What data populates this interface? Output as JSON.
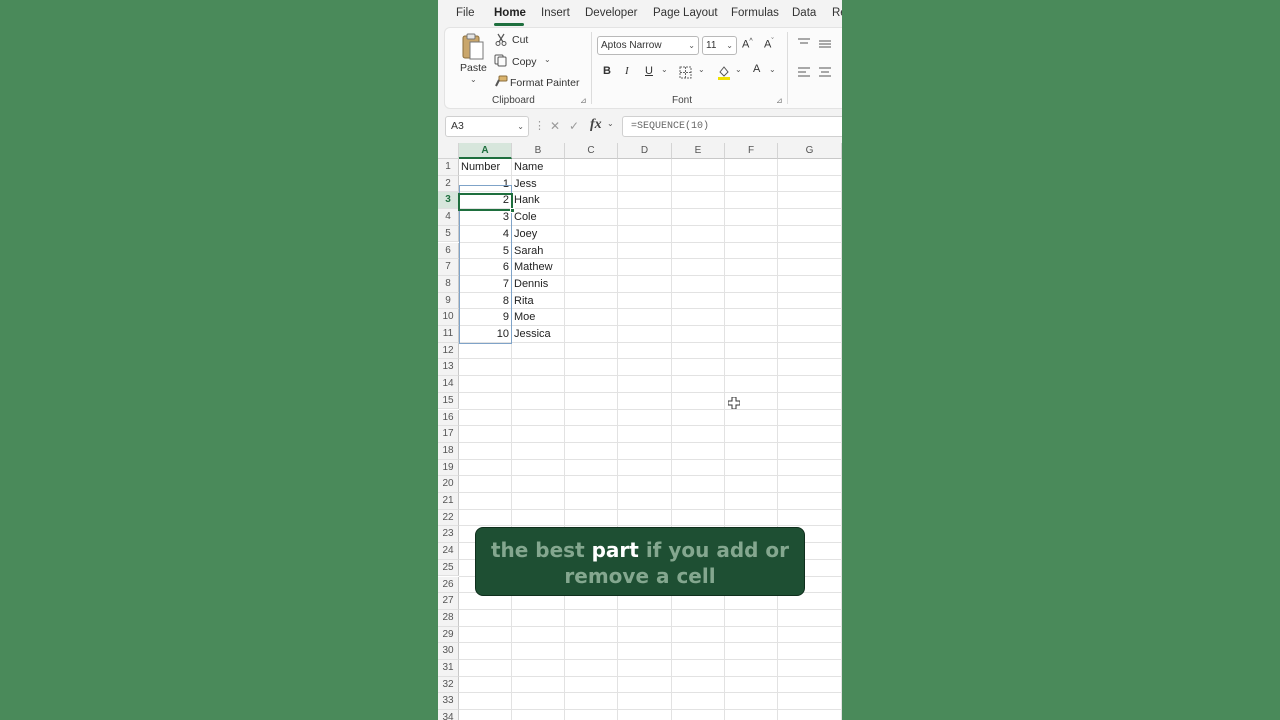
{
  "ribbon": {
    "tabs": [
      "File",
      "Home",
      "Insert",
      "Developer",
      "Page Layout",
      "Formulas",
      "Data",
      "Re"
    ],
    "active_tab": "Home",
    "clipboard": {
      "paste_label": "Paste",
      "cut_label": "Cut",
      "copy_label": "Copy",
      "format_painter_label": "Format Painter",
      "group_label": "Clipboard"
    },
    "font": {
      "font_name": "Aptos Narrow",
      "font_size": "11",
      "bold": "B",
      "italic": "I",
      "underline": "U",
      "increase_font": "A",
      "decrease_font": "A",
      "font_color": "A",
      "group_label": "Font"
    }
  },
  "formula_bar": {
    "name_box": "A3",
    "fx_label": "fx",
    "formula": "=SEQUENCE(10)"
  },
  "grid": {
    "columns": [
      "A",
      "B",
      "C",
      "D",
      "E",
      "F",
      "G"
    ],
    "selected_column": "A",
    "selected_row": 3,
    "rows": [
      "1",
      "2",
      "3",
      "4",
      "5",
      "6",
      "7",
      "8",
      "9",
      "10",
      "11",
      "12",
      "13",
      "14",
      "15",
      "16",
      "17",
      "18",
      "19",
      "20",
      "21",
      "22",
      "23",
      "24",
      "25",
      "26",
      "27",
      "28",
      "29",
      "30",
      "31",
      "32",
      "33",
      "34"
    ],
    "header": {
      "a": "Number",
      "b": "Name"
    },
    "data": [
      {
        "number": "1",
        "name": "Jess"
      },
      {
        "number": "2",
        "name": "Hank"
      },
      {
        "number": "3",
        "name": "Cole"
      },
      {
        "number": "4",
        "name": "Joey"
      },
      {
        "number": "5",
        "name": "Sarah"
      },
      {
        "number": "6",
        "name": "Mathew"
      },
      {
        "number": "7",
        "name": "Dennis"
      },
      {
        "number": "8",
        "name": "Rita"
      },
      {
        "number": "9",
        "name": "Moe"
      },
      {
        "number": "10",
        "name": "Jessica"
      }
    ]
  },
  "caption": {
    "pre": "the best ",
    "highlight": "part",
    "post": " if you add or remove a cell"
  },
  "colors": {
    "accent": "#1e6f3e",
    "background": "#4a8a5a",
    "caption_bg": "#1e4f33",
    "caption_text": "#84a78f"
  }
}
